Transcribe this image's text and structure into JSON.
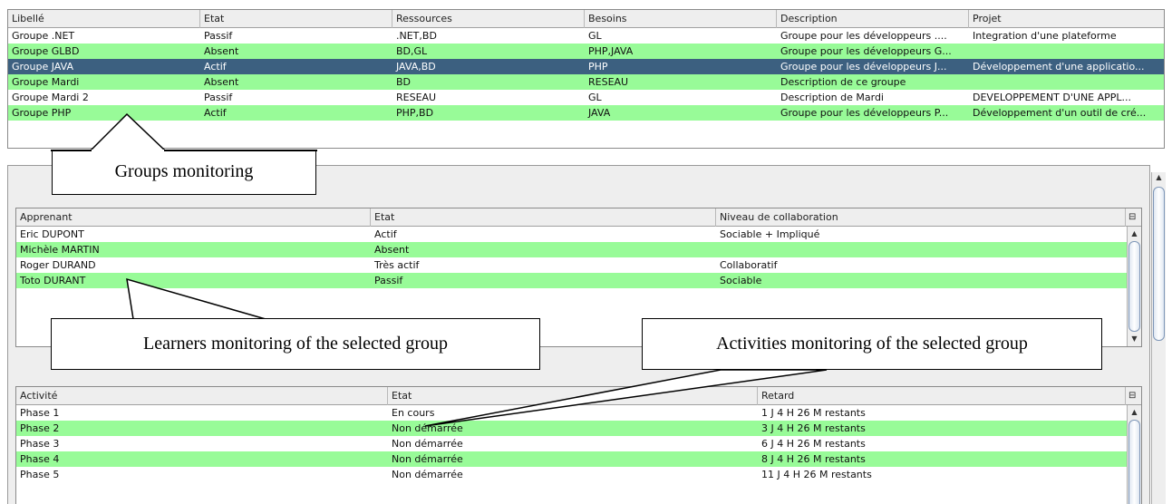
{
  "groups_table": {
    "columns": [
      "Libellé",
      "Etat",
      "Ressources",
      "Besoins",
      "Description",
      "Projet"
    ],
    "rows": [
      [
        "Groupe .NET",
        "Passif",
        ".NET,BD",
        "GL",
        "Groupe pour les développeurs ....",
        "Integration d'une plateforme"
      ],
      [
        "Groupe GLBD",
        "Absent",
        "BD,GL",
        "PHP,JAVA",
        "Groupe pour les développeurs G...",
        ""
      ],
      [
        "Groupe JAVA",
        "Actif",
        "JAVA,BD",
        "PHP",
        "Groupe pour les développeurs J...",
        "Développement d'une applicatio..."
      ],
      [
        "Groupe Mardi",
        "Absent",
        "BD",
        "RESEAU",
        "Description de ce groupe",
        ""
      ],
      [
        "Groupe Mardi 2",
        "Passif",
        "RESEAU",
        "GL",
        "Description de Mardi",
        "DEVELOPPEMENT D'UNE APPL..."
      ],
      [
        "Groupe PHP",
        "Actif",
        "PHP,BD",
        "JAVA",
        "Groupe pour les développeurs P...",
        "Développement d'un outil de cré..."
      ]
    ],
    "selected_row": "Groupe JAVA"
  },
  "learners_table": {
    "columns": [
      "Apprenant",
      "Etat",
      "Niveau de collaboration"
    ],
    "rows": [
      [
        "Eric DUPONT",
        "Actif",
        "Sociable + Impliqué"
      ],
      [
        "Michèle MARTIN",
        "Absent",
        ""
      ],
      [
        "Roger DURAND",
        "Très actif",
        "Collaboratif"
      ],
      [
        "Toto DURANT",
        "Passif",
        "Sociable"
      ]
    ]
  },
  "activities_table": {
    "columns": [
      "Activité",
      "Etat",
      "Retard"
    ],
    "rows": [
      [
        "Phase 1",
        "En cours",
        "1 J 4 H 26 M restants"
      ],
      [
        "Phase 2",
        "Non démarrée",
        "3 J 4 H 26 M restants"
      ],
      [
        "Phase 3",
        "Non démarrée",
        "6 J 4 H 26 M restants"
      ],
      [
        "Phase 4",
        "Non démarrée",
        "8 J 4 H 26 M restants"
      ],
      [
        "Phase 5",
        "Non démarrée",
        "11 J 4 H 26 M restants"
      ]
    ]
  },
  "callouts": {
    "groups": "Groups monitoring",
    "learners": "Learners monitoring of the selected group",
    "activities": "Activities monitoring of the selected group"
  },
  "icons": {
    "column_control": "column-control-icon",
    "scroll_up": "arrow-up-icon",
    "scroll_down": "arrow-down-icon"
  },
  "colors": {
    "row_alt_green": "#98fb98",
    "row_selected": "#3c6080",
    "panel_background": "#eeeeee"
  }
}
